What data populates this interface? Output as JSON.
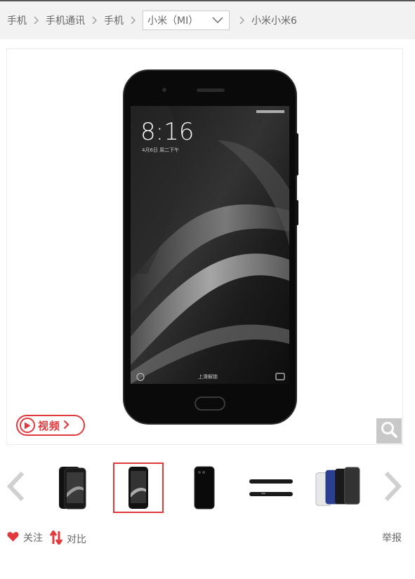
{
  "breadcrumb": {
    "items": [
      "手机",
      "手机通讯",
      "手机"
    ],
    "brand_select": "小米（MI）",
    "product": "小米小米6"
  },
  "phone_screen": {
    "time": "8:16",
    "date": "4月6日 周二下午",
    "unlock_hint": "上滑解锁"
  },
  "video_badge": {
    "label": "视频"
  },
  "thumbnails": {
    "count": 5,
    "selected_index": 1,
    "items": [
      "front-back-view",
      "front-view",
      "back-view",
      "side-view",
      "color-variants"
    ]
  },
  "actions": {
    "follow_label": "关注",
    "compare_label": "对比",
    "report_label": "举报"
  },
  "colors": {
    "accent": "#e4393c",
    "breadcrumb_bg": "#f2f2f2",
    "text": "#666666"
  },
  "icons": [
    "chevron-right-icon",
    "chevron-down-icon",
    "play-icon",
    "magnifier-icon",
    "heart-icon",
    "compare-arrows-icon",
    "arrow-left-icon",
    "arrow-right-icon"
  ]
}
